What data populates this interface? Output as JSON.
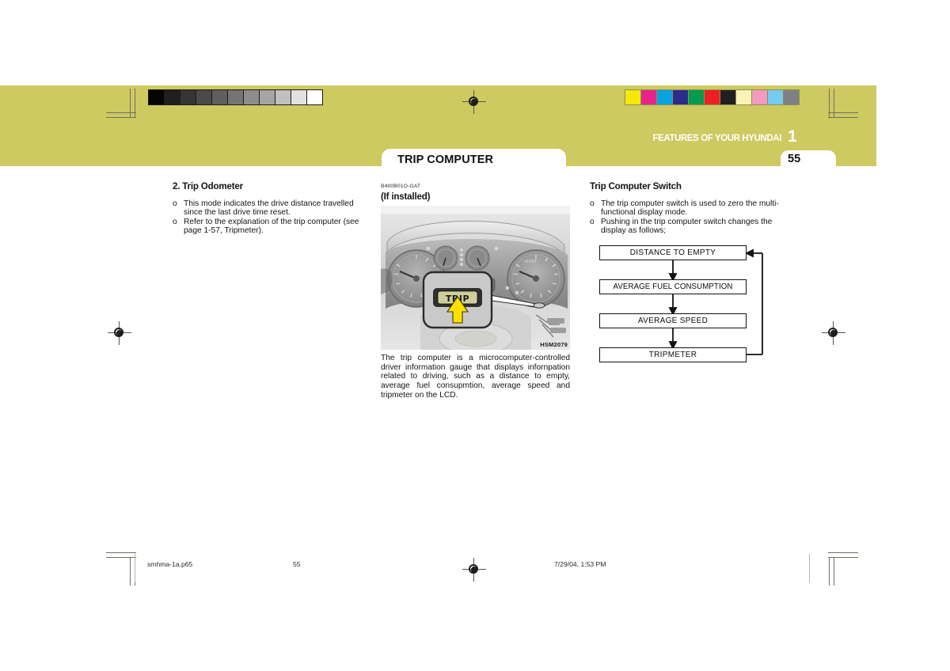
{
  "document": {
    "band_color": "#ccca60",
    "header_title": "FEATURES OF YOUR HYUNDAI",
    "chapter_number": "1",
    "page_number_tab": "55",
    "section_tab_title": "TRIP COMPUTER"
  },
  "calibration": {
    "grayscale_label": "grayscale-calibration-strip",
    "grayscale_swatches": [
      "#050505",
      "#1f1f1f",
      "#353535",
      "#4a4a4a",
      "#5f5f5f",
      "#757575",
      "#8d8d8d",
      "#a5a5a5",
      "#c0c0c0",
      "#e2e2e2",
      "#ffffff"
    ],
    "color_label": "color-calibration-strip",
    "color_swatches": [
      "#f5e90a",
      "#e8248c",
      "#0aa3dd",
      "#2b2d8e",
      "#069a4e",
      "#ec2024",
      "#231f20",
      "#fbf3b6",
      "#f49ac1",
      "#74cdf0",
      "#7e8083"
    ]
  },
  "left_column": {
    "heading": "2. Trip Odometer",
    "bullets": [
      {
        "marker": "o",
        "text": "This mode indicates the drive distance travelled since the last drive time reset."
      },
      {
        "marker": "o",
        "text": "Refer to the explanation of the trip computer (see page 1-57, Tripmeter)."
      }
    ]
  },
  "middle_column": {
    "doc_code": "B400B01O-GAT",
    "subheading": "(If installed)",
    "photo_code": "HSM2079",
    "photo_alt": "instrument-cluster-with-trip-button-callout",
    "photo_callout_label": "TRIP",
    "caption": "The trip computer is a microcomputer-controlled driver information gauge that displays infornpation related to driving, such as a distance to empty, average fuel consupmtion, average speed and tripmeter on the LCD."
  },
  "right_column": {
    "heading": "Trip Computer Switch",
    "bullets": [
      {
        "marker": "o",
        "text": "The trip computer switch is used to zero the multi-functional display mode."
      },
      {
        "marker": "o",
        "text": "Pushing in the trip computer switch changes the display as follows;"
      }
    ],
    "flow_diagram": {
      "boxes": [
        "DISTANCE TO EMPTY",
        "AVERAGE FUEL CONSUMPTION",
        "AVERAGE SPEED",
        "TRIPMETER"
      ]
    }
  },
  "footer": {
    "file_name": "smhma-1a.p65",
    "page_number": "55",
    "timestamp": "7/29/04, 1:53 PM"
  }
}
